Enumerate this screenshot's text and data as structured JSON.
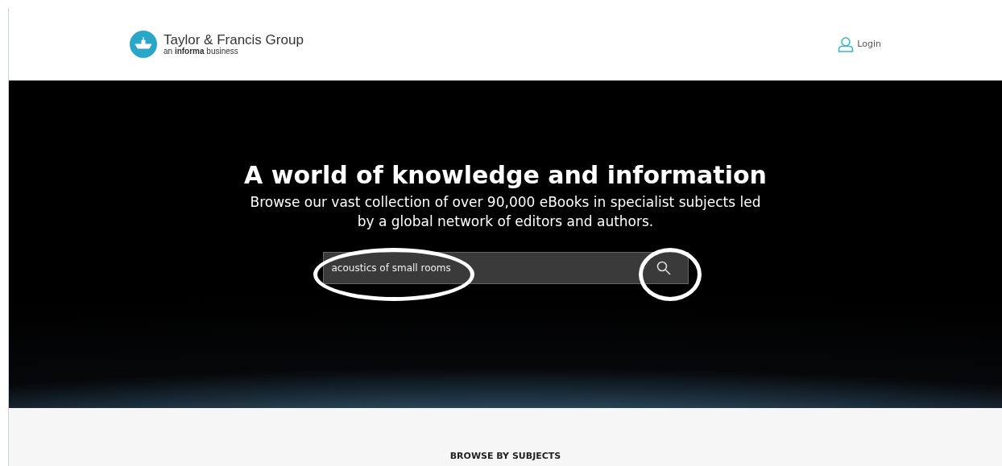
{
  "header": {
    "brand": "Taylor & Francis Group",
    "tagline_prefix": "an ",
    "tagline_bold": "informa",
    "tagline_suffix": " business",
    "login": "Login"
  },
  "hero": {
    "title": "A world of knowledge and information",
    "subtitle": "Browse our vast collection of over 90,000 eBooks in specialist subjects led by a global network of editors and authors.",
    "search": {
      "value": "acoustics of small rooms"
    }
  },
  "annotations": [
    {
      "kind": "ellipse"
    },
    {
      "kind": "circle"
    }
  ],
  "browse": {
    "heading": "BROWSE BY SUBJECTS"
  }
}
